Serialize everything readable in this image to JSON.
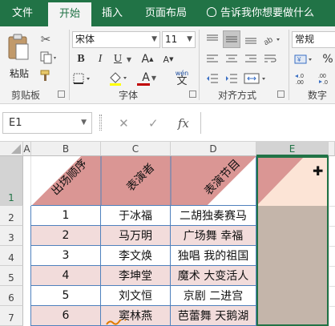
{
  "tabs": [
    {
      "label": "文件",
      "active": false
    },
    {
      "label": "开始",
      "active": true
    },
    {
      "label": "插入",
      "active": false
    },
    {
      "label": "页面布局",
      "active": false
    }
  ],
  "tell_me": "告诉我你想要做什么",
  "clipboard": {
    "paste_label": "粘贴",
    "group_label": "剪贴板"
  },
  "font": {
    "name": "宋体",
    "size": "11",
    "group_label": "字体",
    "bold": "B",
    "italic": "I",
    "underline": "U",
    "grow": "A",
    "shrink": "A",
    "font_color_letter": "A",
    "wen": "wén",
    "wen_char": "文"
  },
  "alignment": {
    "group_label": "对齐方式"
  },
  "number": {
    "format": "常规",
    "group_label": "数字",
    "percent": "%",
    "inc": "←.0\n.00",
    "dec": ".00\n→.0"
  },
  "formula_bar": {
    "name_box": "E1",
    "cancel": "✕",
    "enter": "✓",
    "fx": "fx",
    "value": ""
  },
  "colors": {
    "accent": "#217346",
    "header_band": "#da9694",
    "pink_row": "#f2dcdb",
    "selection_fill": "#c4b5aa",
    "triangle_light": "#fce4d6",
    "border": "#4f81bd"
  },
  "columns": [
    "A",
    "B",
    "C",
    "D",
    "E"
  ],
  "rows": [
    "1",
    "2",
    "3",
    "4",
    "5",
    "6",
    "7"
  ],
  "header": {
    "b": "出场顺序",
    "c": "表演者",
    "d": "表演节目"
  },
  "table": [
    {
      "no": "1",
      "name": "于冰福",
      "show": "二胡独奏赛马"
    },
    {
      "no": "2",
      "name": "马万明",
      "show": "广场舞 幸福"
    },
    {
      "no": "3",
      "name": "李文焕",
      "show": "独唱 我的祖国"
    },
    {
      "no": "4",
      "name": "李坤堂",
      "show": "魔术 大变活人"
    },
    {
      "no": "5",
      "name": "刘文恒",
      "show": "京剧 二进宫"
    },
    {
      "no": "6",
      "name": "窦林燕",
      "show": "芭蕾舞 天鹅湖"
    }
  ]
}
